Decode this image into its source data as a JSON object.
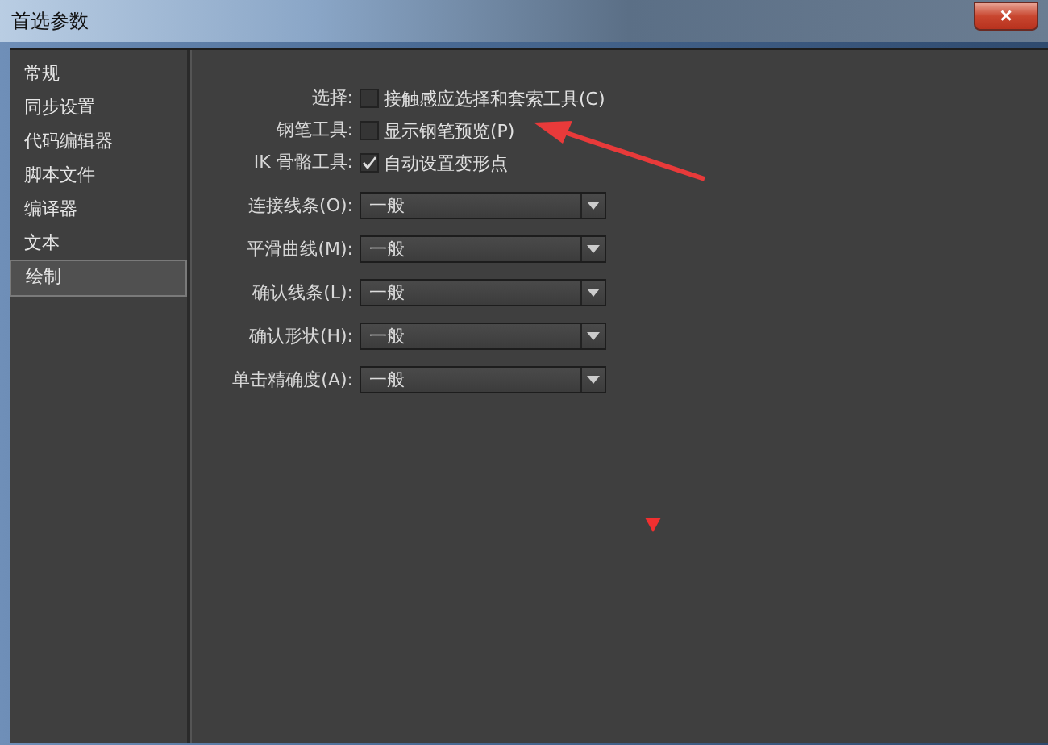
{
  "window": {
    "title": "首选参数",
    "close": "×"
  },
  "sidebar": {
    "items": [
      {
        "label": "常规",
        "selected": false
      },
      {
        "label": "同步设置",
        "selected": false
      },
      {
        "label": "代码编辑器",
        "selected": false
      },
      {
        "label": "脚本文件",
        "selected": false
      },
      {
        "label": "编译器",
        "selected": false
      },
      {
        "label": "文本",
        "selected": false
      },
      {
        "label": "绘制",
        "selected": true
      }
    ]
  },
  "options": [
    {
      "label": "选择:",
      "text": "接触感应选择和套索工具(C)",
      "checked": false
    },
    {
      "label": "钢笔工具:",
      "text": "显示钢笔预览(P)",
      "checked": false
    },
    {
      "label": "IK 骨骼工具:",
      "text": "自动设置变形点",
      "checked": true
    }
  ],
  "dropdowns": [
    {
      "label": "连接线条(O):",
      "value": "一般"
    },
    {
      "label": "平滑曲线(M):",
      "value": "一般"
    },
    {
      "label": "确认线条(L):",
      "value": "一般"
    },
    {
      "label": "确认形状(H):",
      "value": "一般"
    },
    {
      "label": "单击精确度(A):",
      "value": "一般"
    }
  ]
}
